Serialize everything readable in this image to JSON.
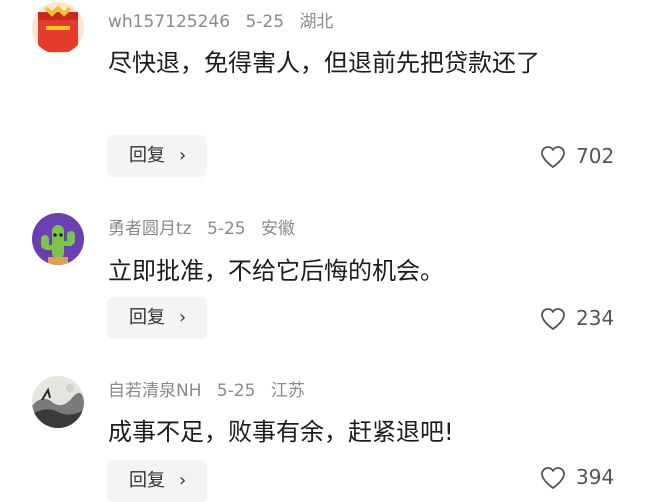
{
  "comments": [
    {
      "username": "wh157125246",
      "date": "5-25",
      "location": "湖北",
      "text": "尽快退，免得害人，但退前先把贷款还了",
      "reply_label": "回复",
      "likes": "702",
      "avatar_icon": "red-lantern-avatar-icon",
      "colors": {
        "primary": "#e43b2c",
        "accent": "#f3c02f"
      }
    },
    {
      "username": "勇者圆月tz",
      "date": "5-25",
      "location": "安徽",
      "text": "立即批准，不给它后悔的机会。",
      "reply_label": "回复",
      "likes": "234",
      "avatar_icon": "cactus-avatar-icon",
      "colors": {
        "primary": "#6b3fb0",
        "accent": "#7cc44a"
      }
    },
    {
      "username": "自若清泉NH",
      "date": "5-25",
      "location": "江苏",
      "text": "成事不足，败事有余，赶紧退吧!",
      "reply_label": "回复",
      "likes": "394",
      "avatar_icon": "landscape-painting-avatar-icon",
      "colors": {
        "primary": "#3a3a3a",
        "accent": "#cfcfcf"
      }
    }
  ],
  "icons": {
    "reply_chevron": "chevron-right-icon",
    "like": "heart-outline-icon"
  }
}
